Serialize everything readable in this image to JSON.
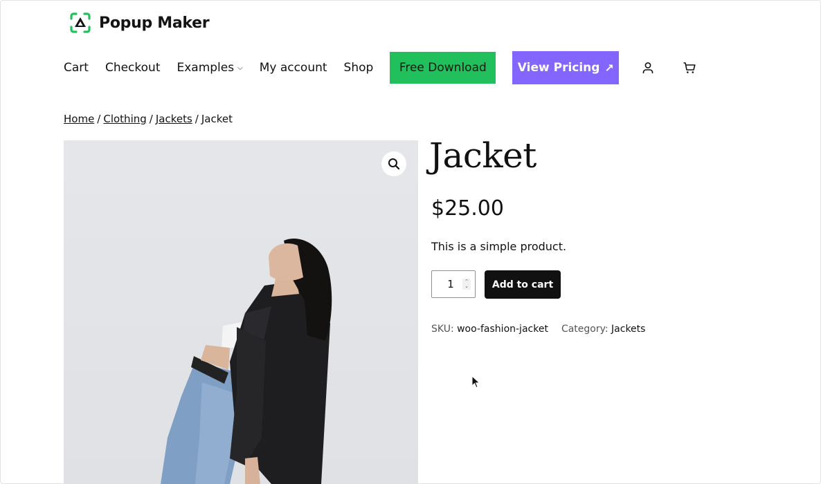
{
  "brand": {
    "name": "Popup Maker",
    "logo_color": "#21c05c"
  },
  "nav": {
    "items": [
      {
        "label": "Cart"
      },
      {
        "label": "Checkout"
      },
      {
        "label": "Examples",
        "chevron": "⌵"
      },
      {
        "label": "My account"
      },
      {
        "label": "Shop"
      }
    ],
    "free_download": "Free Download",
    "view_pricing": "View Pricing",
    "pricing_arrow": "↗",
    "free_download_color": "#21c05c",
    "view_pricing_color": "#8266ff",
    "icons": [
      "account-icon",
      "cart-icon"
    ]
  },
  "breadcrumb": {
    "items": [
      "Home",
      "Clothing",
      "Jackets"
    ],
    "current": "Jacket",
    "separator": "/"
  },
  "product": {
    "title": "Jacket",
    "price": "$25.00",
    "description": "This is a simple product.",
    "quantity": "1",
    "add_to_cart": "Add to cart",
    "sku_label": "SKU:",
    "sku": "woo-fashion-jacket",
    "category_label": "Category:",
    "category": "Jackets"
  }
}
